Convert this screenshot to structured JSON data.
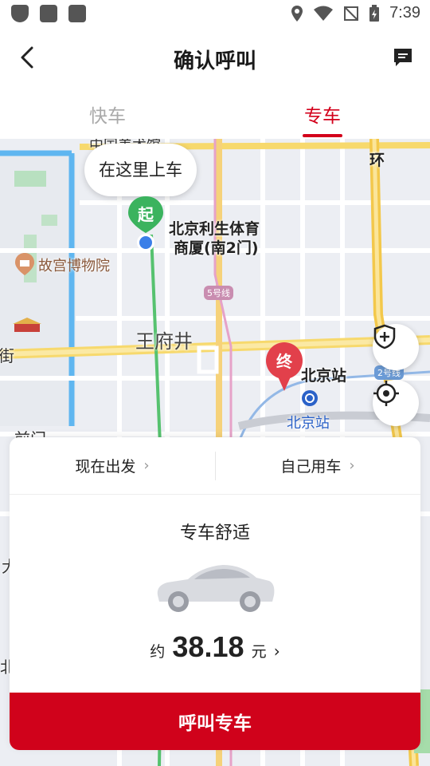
{
  "status_bar": {
    "time": "7:39"
  },
  "header": {
    "title": "确认呼叫"
  },
  "tabs": [
    {
      "label": "快车",
      "active": false
    },
    {
      "label": "专车",
      "active": true
    }
  ],
  "map": {
    "pickup_bubble": "在这里上车",
    "start_marker": "起",
    "end_marker": "终",
    "labels": {
      "pickup_place_line1": "北京利生体育",
      "pickup_place_line2": "商厦(南2门)",
      "palace_museum": "故宫博物院",
      "wangfujing": "王府井",
      "beijing_station_dest": "北京站",
      "beijing_station_subway": "北京站",
      "top_road": "中国美术馆",
      "ring": "环",
      "street_left": "街",
      "qianmen": "前门",
      "edge_a": "大",
      "edge_b": "北"
    },
    "line_badges": {
      "line5": "5号线",
      "line2": "2号线"
    }
  },
  "card": {
    "option_depart": "现在出发",
    "option_usage": "自己用车",
    "car_type": "专车舒适",
    "price_prefix": "约",
    "price": "38.18",
    "price_unit": "元",
    "call_button": "呼叫专车"
  },
  "colors": {
    "brand_red": "#d0021b",
    "start_green": "#3bb35e",
    "end_red": "#e2404b"
  }
}
